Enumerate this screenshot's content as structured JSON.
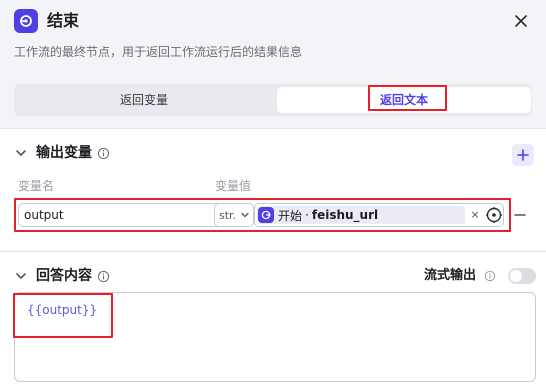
{
  "node": {
    "title": "结束",
    "description": "工作流的最终节点，用于返回工作流运行后的结果信息",
    "icon": "end-node-icon",
    "accent_color": "#4e40e5"
  },
  "mode_tabs": [
    {
      "label": "返回变量",
      "selected": false
    },
    {
      "label": "返回文本",
      "selected": true
    }
  ],
  "output_section": {
    "title": "输出变量",
    "column_name_label": "变量名",
    "column_value_label": "变量值",
    "rows": [
      {
        "name": "output",
        "type": "str.",
        "ref_node": "开始",
        "ref_separator": "·",
        "ref_variable": "feishu_url",
        "clear_glyph": "×"
      }
    ]
  },
  "answer_section": {
    "title": "回答内容",
    "stream_label": "流式输出",
    "stream_enabled": false,
    "content": "{{output}}"
  },
  "highlight_color": "#e5202a"
}
